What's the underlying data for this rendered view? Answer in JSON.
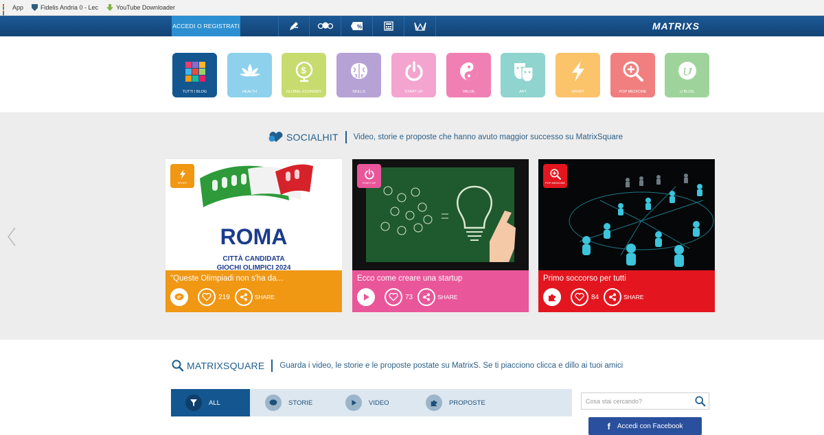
{
  "bookmarks": [
    {
      "label": "App",
      "icon": "apps-grid-icon"
    },
    {
      "label": "Fidelis Andria 0 - Lec",
      "icon": "shield-icon"
    },
    {
      "label": "YouTube Downloader",
      "icon": "download-icon"
    }
  ],
  "topnav": {
    "login_label": "ACCEDI O REGISTRATI",
    "icons": [
      "pencil-pen-icon",
      "people-icon",
      "percent-tag-icon",
      "calculator-icon",
      "crown-icon"
    ],
    "logo": "MATRIXS",
    "bg_color": "#124376"
  },
  "categories": [
    {
      "label": "TUTTI I BLOG",
      "color": "#14568f",
      "icon": "grid-mosaic-icon"
    },
    {
      "label": "HEALTH",
      "color": "#8ed1ec",
      "icon": "lotus-icon"
    },
    {
      "label": "GLOBAL ECONOMY",
      "color": "#c7dc6e",
      "icon": "dollar-globe-icon"
    },
    {
      "label": "SKILLS",
      "color": "#b7a2d6",
      "icon": "brain-icon"
    },
    {
      "label": "START UP",
      "color": "#f3a5cf",
      "icon": "power-icon"
    },
    {
      "label": "VALUE",
      "color": "#f07fb4",
      "icon": "yin-yang-icon"
    },
    {
      "label": "ART",
      "color": "#8fd4ce",
      "icon": "masks-icon"
    },
    {
      "label": "SPORT",
      "color": "#fbc36a",
      "icon": "lightning-icon"
    },
    {
      "label": "POP MEDICINE",
      "color": "#f17f7f",
      "icon": "magnifier-plus-icon"
    },
    {
      "label": "U BLOG",
      "color": "#9ed49b",
      "icon": "u-blog-icon"
    }
  ],
  "socialhit": {
    "title": "SOCIALHIT",
    "description": "Video, storie e proposte che hanno avuto maggior successo su MatrixSquare",
    "cards": [
      {
        "title": "\"Queste Olimpiadi non s'ha da...",
        "category": "SPORT",
        "color": "#f09714",
        "type_icon": "chat-bubble-icon",
        "likes": "219",
        "share_label": "SHARE",
        "image": {
          "headline": "ROMA",
          "sub1": "CITTÀ CANDIDATA",
          "sub2": "GIOCHI OLIMPICI 2024"
        }
      },
      {
        "title": "Ecco come creare una startup",
        "category": "START UP",
        "color": "#e9569a",
        "type_icon": "play-icon",
        "likes": "73",
        "share_label": "SHARE"
      },
      {
        "title": "Primo soccorso per tutti",
        "category": "POP MEDICINE",
        "color": "#e3161f",
        "type_icon": "puzzle-icon",
        "likes": "84",
        "share_label": "SHARE"
      }
    ]
  },
  "matrixsquare": {
    "title": "MATRIXSQUARE",
    "description": "Guarda i video, le storie e le proposte postate su MatrixS. Se ti piacciono clicca e dillo ai tuoi amici",
    "filters": [
      {
        "label": "ALL",
        "icon": "filter-funnel-icon",
        "active": true
      },
      {
        "label": "STORIE",
        "icon": "chat-bubble-icon",
        "active": false
      },
      {
        "label": "VIDEO",
        "icon": "play-icon",
        "active": false
      },
      {
        "label": "PROPOSTE",
        "icon": "puzzle-icon",
        "active": false
      }
    ],
    "search_placeholder": "Cosa stai cercando?",
    "facebook_label": "Accedi con Facebook"
  }
}
